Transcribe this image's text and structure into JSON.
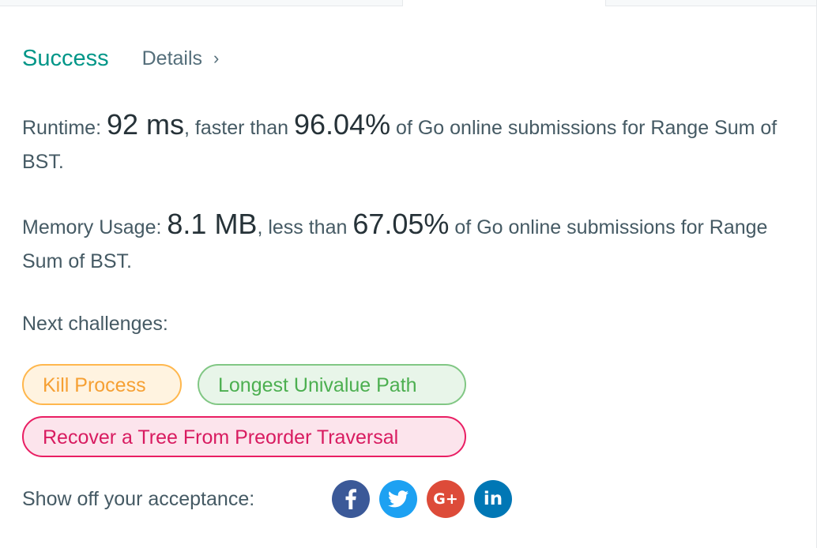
{
  "status": {
    "text": "Success",
    "details_label": "Details",
    "details_chevron": "›"
  },
  "runtime": {
    "label": "Runtime: ",
    "value": "92 ms",
    "middle": ", faster than ",
    "percent": "96.04%",
    "suffix": " of Go online submissions for Range Sum of BST."
  },
  "memory": {
    "label": "Memory Usage: ",
    "value": "8.1 MB",
    "middle": ", less than ",
    "percent": "67.05%",
    "suffix": " of Go online submissions for Range Sum of BST."
  },
  "next_challenges": {
    "label": "Next challenges:",
    "items": [
      {
        "label": "Kill Process",
        "difficulty_color": "#f6a033"
      },
      {
        "label": "Longest Univalue Path",
        "difficulty_color": "#4caf50"
      },
      {
        "label": "Recover a Tree From Preorder Traversal",
        "difficulty_color": "#d81b60"
      }
    ]
  },
  "share": {
    "label": "Show off your acceptance:",
    "buttons": [
      {
        "icon": "facebook-icon",
        "color": "#3b5998"
      },
      {
        "icon": "twitter-icon",
        "color": "#1da1f2",
        "glyph": ""
      },
      {
        "icon": "google-plus-icon",
        "color": "#dd4b39",
        "glyph": "G+"
      },
      {
        "icon": "linkedin-icon",
        "color": "#0077b5",
        "glyph": "in"
      }
    ]
  },
  "colors": {
    "success": "#009688",
    "text": "#455a64"
  }
}
